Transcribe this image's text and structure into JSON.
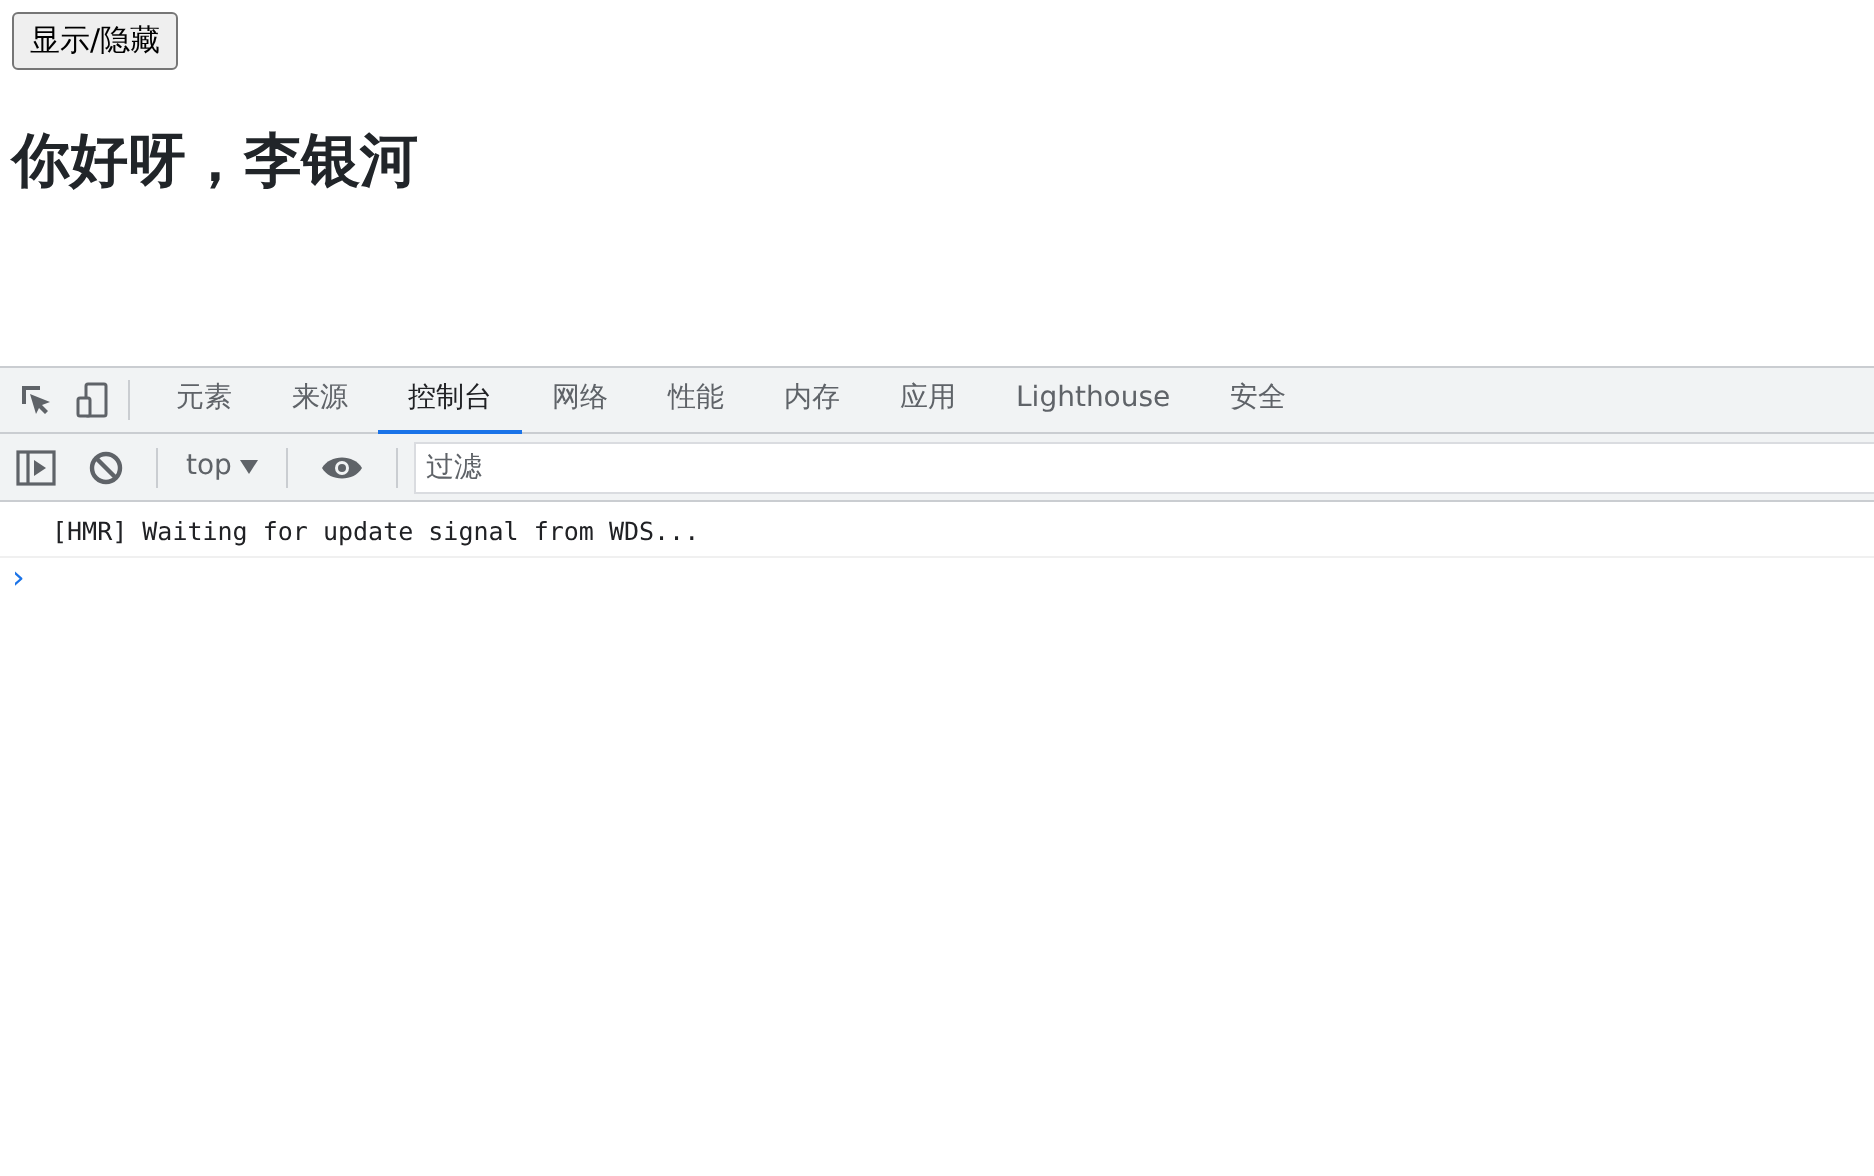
{
  "page": {
    "button": "显示/隐藏",
    "heading": "你好呀，李银河"
  },
  "devtools": {
    "tabs": [
      {
        "label": "元素",
        "selected": false
      },
      {
        "label": "来源",
        "selected": false
      },
      {
        "label": "控制台",
        "selected": true
      },
      {
        "label": "网络",
        "selected": false
      },
      {
        "label": "性能",
        "selected": false
      },
      {
        "label": "内存",
        "selected": false
      },
      {
        "label": "应用",
        "selected": false
      },
      {
        "label": "Lighthouse",
        "selected": false
      },
      {
        "label": "安全",
        "selected": false
      }
    ],
    "context": "top",
    "filter": {
      "placeholder": "过滤"
    },
    "messages": [
      "[HMR] Waiting for update signal from WDS..."
    ],
    "prompt": "›"
  }
}
